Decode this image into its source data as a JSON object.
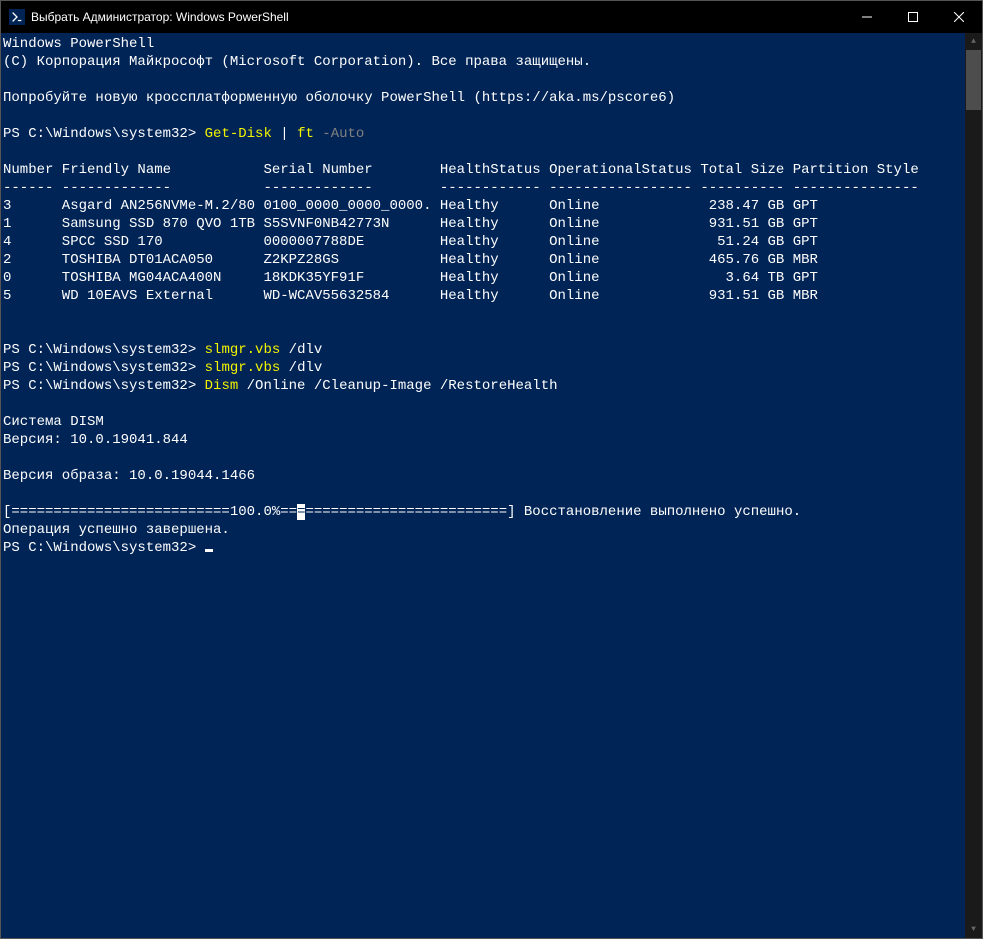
{
  "window": {
    "title": "Выбрать Администратор: Windows PowerShell"
  },
  "header": {
    "line1": "Windows PowerShell",
    "line2": "(C) Корпорация Майкрософт (Microsoft Corporation). Все права защищены.",
    "line3": "Попробуйте новую кроссплатформенную оболочку PowerShell (https://aka.ms/pscore6)"
  },
  "prompt1": {
    "path": "PS C:\\Windows\\system32> ",
    "cmd1": "Get-Disk",
    "pipe": " | ",
    "cmd2": "ft",
    "arg": " -Auto"
  },
  "table": {
    "headers": {
      "number": "Number",
      "friendly": "Friendly Name",
      "serial": "Serial Number",
      "health": "HealthStatus",
      "opstatus": "OperationalStatus",
      "size": "Total Size",
      "partition": "Partition Style"
    },
    "sep": {
      "number": "------",
      "friendly": "-------------",
      "serial": "-------------",
      "health": "------------",
      "opstatus": "-----------------",
      "size": "----------",
      "partition": "---------------"
    },
    "rows": [
      {
        "number": "3",
        "friendly": "Asgard AN256NVMe-M.2/80",
        "serial": "0100_0000_0000_0000.",
        "health": "Healthy",
        "opstatus": "Online",
        "size": "238.47 GB",
        "partition": "GPT"
      },
      {
        "number": "1",
        "friendly": "Samsung SSD 870 QVO 1TB",
        "serial": "S5SVNF0NB42773N",
        "health": "Healthy",
        "opstatus": "Online",
        "size": "931.51 GB",
        "partition": "GPT"
      },
      {
        "number": "4",
        "friendly": "SPCC SSD 170",
        "serial": "0000007788DE",
        "health": "Healthy",
        "opstatus": "Online",
        "size": "51.24 GB",
        "partition": "GPT"
      },
      {
        "number": "2",
        "friendly": "TOSHIBA DT01ACA050",
        "serial": "Z2KPZ28GS",
        "health": "Healthy",
        "opstatus": "Online",
        "size": "465.76 GB",
        "partition": "MBR"
      },
      {
        "number": "0",
        "friendly": "TOSHIBA MG04ACA400N",
        "serial": "18KDK35YF91F",
        "health": "Healthy",
        "opstatus": "Online",
        "size": "3.64 TB",
        "partition": "GPT"
      },
      {
        "number": "5",
        "friendly": "WD 10EAVS External",
        "serial": "WD-WCAV55632584",
        "health": "Healthy",
        "opstatus": "Online",
        "size": "931.51 GB",
        "partition": "MBR"
      }
    ]
  },
  "prompt2": {
    "path": "PS C:\\Windows\\system32> ",
    "cmd": "slmgr.vbs",
    "args": " /dlv"
  },
  "prompt3": {
    "path": "PS C:\\Windows\\system32> ",
    "cmd": "slmgr.vbs",
    "args": " /dlv"
  },
  "prompt4": {
    "path": "PS C:\\Windows\\system32> ",
    "cmd": "Dism",
    "args": " /Online /Cleanup-Image /RestoreHealth"
  },
  "dism": {
    "line1": "Cистема DISM",
    "line2": "Версия: 10.0.19041.844",
    "line3": "Версия образа: 10.0.19044.1466",
    "progress_left": "[==========================100.0%==",
    "progress_mid": "=",
    "progress_right": "========================] Восстановление выполнено успешно.",
    "done": "Операция успешно завершена."
  },
  "prompt5": {
    "path": "PS C:\\Windows\\system32> "
  }
}
